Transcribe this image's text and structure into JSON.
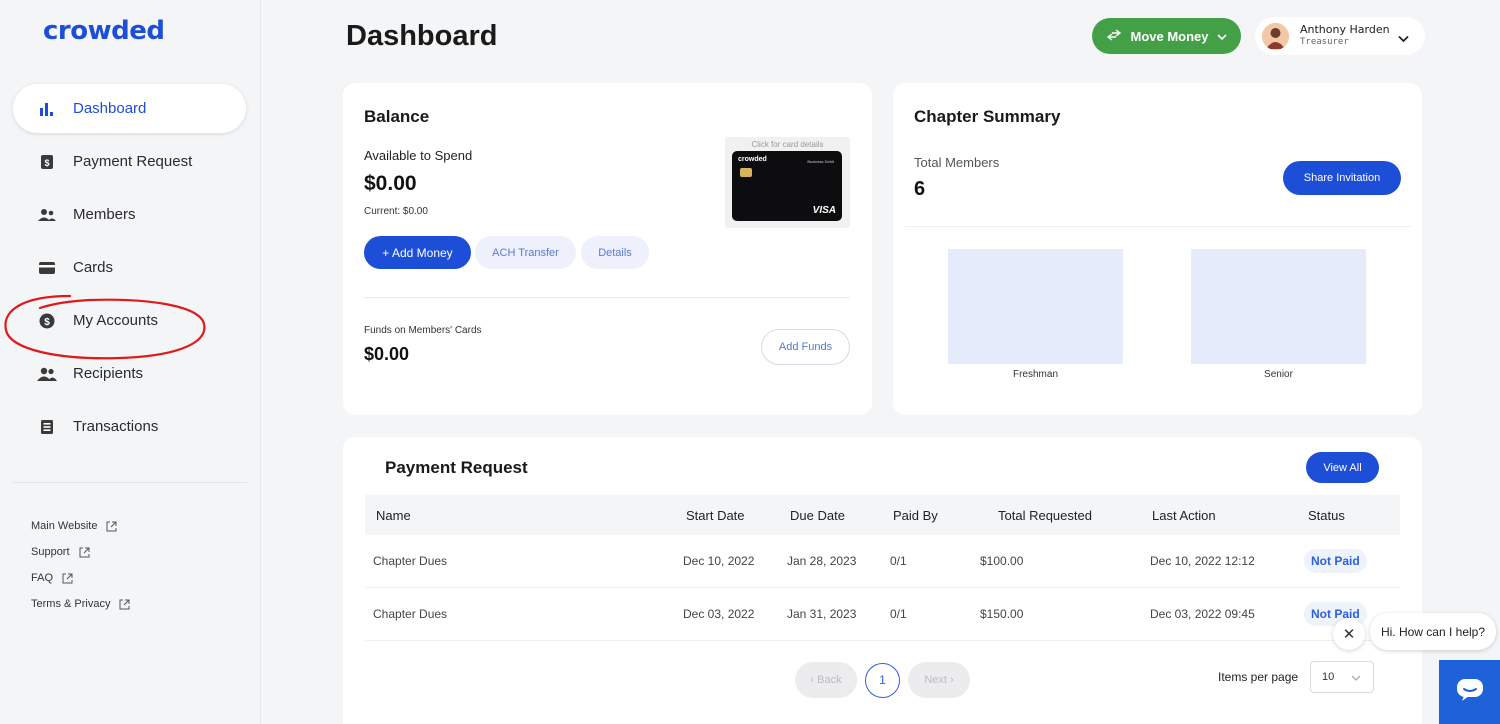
{
  "brand": {
    "logo_text": "crowded",
    "accent": "#1d4ed8",
    "green": "#43a047"
  },
  "sidebar": {
    "items": [
      {
        "label": "Dashboard",
        "icon": "bar-chart-icon",
        "active": true
      },
      {
        "label": "Payment Request",
        "icon": "dollar-doc-icon"
      },
      {
        "label": "Members",
        "icon": "members-icon"
      },
      {
        "label": "Cards",
        "icon": "card-icon"
      },
      {
        "label": "My Accounts",
        "icon": "dollar-circle-icon"
      },
      {
        "label": "Recipients",
        "icon": "recipients-icon"
      },
      {
        "label": "Transactions",
        "icon": "list-doc-icon"
      }
    ],
    "links": [
      {
        "label": "Main Website",
        "icon": "external-link-icon"
      },
      {
        "label": "Support",
        "icon": "external-link-icon"
      },
      {
        "label": "FAQ",
        "icon": "external-link-icon"
      },
      {
        "label": "Terms & Privacy",
        "icon": "external-link-icon"
      }
    ]
  },
  "header": {
    "title": "Dashboard",
    "move_money_label": "Move Money",
    "user": {
      "name": "Anthony Harden",
      "role": "Treasurer"
    }
  },
  "balance": {
    "title": "Balance",
    "available_label": "Available to Spend",
    "available_amount": "$0.00",
    "current_text": "Current: $0.00",
    "add_money_label": "+ Add Money",
    "ach_label": "ACH Transfer",
    "details_label": "Details",
    "card_hint": "Click for card details",
    "card_brand": "crowded",
    "card_type": "Business Debit",
    "card_network": "VISA",
    "funds_label": "Funds on Members' Cards",
    "funds_amount": "$0.00",
    "add_funds_label": "Add Funds"
  },
  "summary": {
    "title": "Chapter Summary",
    "total_members_label": "Total Members",
    "total_members_value": "6",
    "share_label": "Share Invitation",
    "chart_data": {
      "type": "bar",
      "categories": [
        "Freshman",
        "Senior"
      ],
      "bar_color": "#e6ebfb"
    }
  },
  "payments": {
    "title": "Payment Request",
    "view_all_label": "View All",
    "columns": [
      "Name",
      "Start Date",
      "Due Date",
      "Paid By",
      "Total Requested",
      "Last Action",
      "Status"
    ],
    "rows": [
      {
        "name": "Chapter Dues",
        "start": "Dec 10, 2022",
        "due": "Jan 28, 2023",
        "paid_by": "0/1",
        "total": "$100.00",
        "last_action": "Dec 10, 2022 12:12",
        "status": "Not Paid"
      },
      {
        "name": "Chapter Dues",
        "start": "Dec 03, 2022",
        "due": "Jan 31, 2023",
        "paid_by": "0/1",
        "total": "$150.00",
        "last_action": "Dec 03, 2022 09:45",
        "status": "Not Paid"
      }
    ],
    "pager": {
      "back_label": "‹ Back",
      "page": "1",
      "next_label": "Next ›"
    },
    "items_per_page_label": "Items per page",
    "items_per_page_value": "10"
  },
  "chat": {
    "greeting": "Hi. How can I help?",
    "close_symbol": "✕"
  }
}
